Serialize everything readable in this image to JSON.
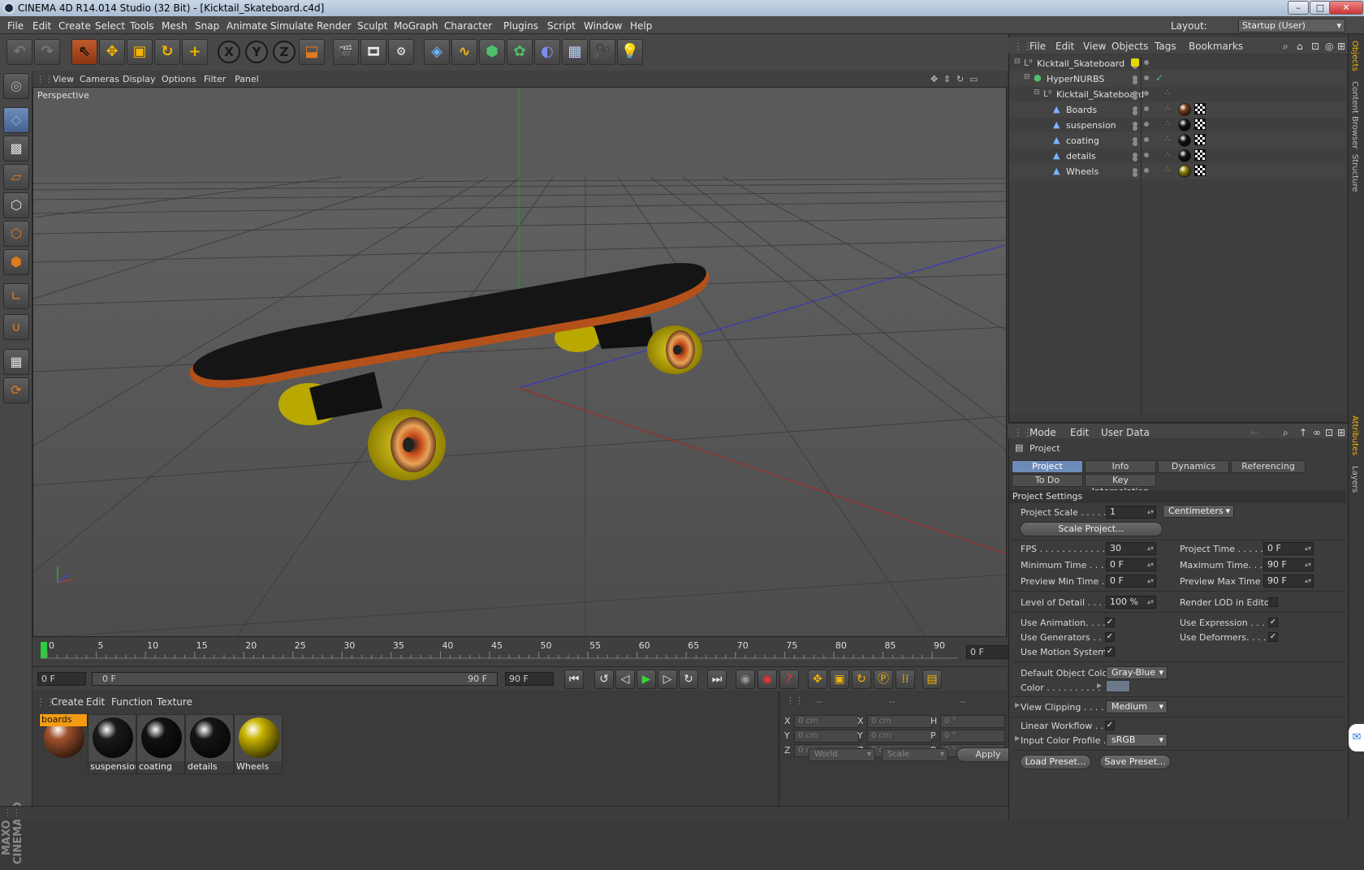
{
  "window": {
    "title": "CINEMA 4D R14.014 Studio (32 Bit) - [Kicktail_Skateboard.c4d]",
    "minimize": "–",
    "maximize": "□",
    "close": "✕"
  },
  "menubar": {
    "items": [
      "File",
      "Edit",
      "Create",
      "Select",
      "Tools",
      "Mesh",
      "Snap",
      "Animate",
      "Simulate",
      "Render",
      "Sculpt",
      "MoGraph",
      "Character",
      "Plugins",
      "Script",
      "Window",
      "Help"
    ],
    "layout_label": "Layout:",
    "layout_value": "Startup (User)"
  },
  "toolbar": {
    "axis_x": "X",
    "axis_y": "Y",
    "axis_z": "Z"
  },
  "viewport": {
    "menu": [
      "View",
      "Cameras",
      "Display",
      "Options",
      "Filter",
      "Panel"
    ],
    "label": "Perspective"
  },
  "timeline": {
    "ticks": [
      "0",
      "5",
      "10",
      "15",
      "20",
      "25",
      "30",
      "35",
      "40",
      "45",
      "50",
      "55",
      "60",
      "65",
      "70",
      "75",
      "80",
      "85",
      "90"
    ],
    "current_frame": "0 F"
  },
  "playback": {
    "start_field": "0 F",
    "range_start": "0 F",
    "range_end": "90 F",
    "end_field": "90 F"
  },
  "materials": {
    "menu": [
      "Create",
      "Edit",
      "Function",
      "Texture"
    ],
    "items": [
      {
        "name": "boards",
        "selected": true,
        "color": "#a0522d"
      },
      {
        "name": "suspension",
        "selected": false,
        "color": "#1a1a1a"
      },
      {
        "name": "coating",
        "selected": false,
        "color": "#111111"
      },
      {
        "name": "details",
        "selected": false,
        "color": "#151515"
      },
      {
        "name": "Wheels",
        "selected": false,
        "color": "#c8b400"
      }
    ]
  },
  "coordinates": {
    "headers": [
      "--",
      "--",
      "--"
    ],
    "rows": [
      {
        "a": "X",
        "av": "0 cm",
        "b": "X",
        "bv": "0 cm",
        "c": "H",
        "cv": "0 °"
      },
      {
        "a": "Y",
        "av": "0 cm",
        "b": "Y",
        "bv": "0 cm",
        "c": "P",
        "cv": "0 °"
      },
      {
        "a": "Z",
        "av": "0 cm",
        "b": "Z",
        "bv": "0 cm",
        "c": "B",
        "cv": "0 °"
      }
    ],
    "mode1": "World",
    "mode2": "Scale",
    "apply": "Apply"
  },
  "objects": {
    "menu": [
      "File",
      "Edit",
      "View",
      "Objects",
      "Tags",
      "Bookmarks"
    ],
    "tree": [
      {
        "name": "Kicktail_Skateboard",
        "indent": 0,
        "type": "null"
      },
      {
        "name": "HyperNURBS",
        "indent": 1,
        "type": "nurbs"
      },
      {
        "name": "Kicktail_Skateboard",
        "indent": 2,
        "type": "null"
      },
      {
        "name": "Boards",
        "indent": 3,
        "type": "poly",
        "tag": "#7a3a18"
      },
      {
        "name": "suspension",
        "indent": 3,
        "type": "poly",
        "tag": "#111111"
      },
      {
        "name": "coating",
        "indent": 3,
        "type": "poly",
        "tag": "#111111"
      },
      {
        "name": "details",
        "indent": 3,
        "type": "poly",
        "tag": "#111111"
      },
      {
        "name": "Wheels",
        "indent": 3,
        "type": "poly",
        "tag": "#8a7a00"
      }
    ]
  },
  "attributes": {
    "menu": [
      "Mode",
      "Edit",
      "User Data"
    ],
    "object_label": "Project",
    "tabs": [
      "Project Settings",
      "Info",
      "Dynamics",
      "Referencing",
      "To Do",
      "Key Interpolation"
    ],
    "section": "Project Settings",
    "project_scale_label": "Project Scale . . . . . .",
    "project_scale_value": "1",
    "units": "Centimeters",
    "scale_project": "Scale Project...",
    "fps_label": "FPS . . . . . . . . . . . . . .",
    "fps_value": "30",
    "project_time_label": "Project Time . . . . . . . .",
    "project_time_value": "0 F",
    "min_time_label": "Minimum Time . . . . .",
    "min_time_value": "0 F",
    "max_time_label": "Maximum Time. . . . . .",
    "max_time_value": "90 F",
    "prev_min_label": "Preview Min Time . .",
    "prev_min_value": "0 F",
    "prev_max_label": "Preview Max Time . . .",
    "prev_max_value": "90 F",
    "lod_label": "Level of Detail . . . . .",
    "lod_value": "100 %",
    "render_lod_label": "Render LOD in Editor",
    "use_anim_label": "Use Animation. . . . .",
    "use_expr_label": "Use Expression . . . . .",
    "use_gen_label": "Use Generators . . . .",
    "use_def_label": "Use Deformers. . . . . .",
    "use_motion_label": "Use Motion System",
    "default_color_label": "Default Object Color",
    "default_color_value": "Gray-Blue",
    "color_label": "Color . . . . . . . . . .",
    "view_clipping_label": "View Clipping . . . . .",
    "view_clipping_value": "Medium",
    "linear_workflow_label": "Linear Workflow . . .",
    "input_color_label": "Input Color Profile .",
    "input_color_value": "sRGB",
    "load_preset": "Load Preset...",
    "save_preset": "Save Preset..."
  },
  "sidetabs": [
    "Objects",
    "Content Browser",
    "Structure",
    "Attributes",
    "Layers"
  ]
}
